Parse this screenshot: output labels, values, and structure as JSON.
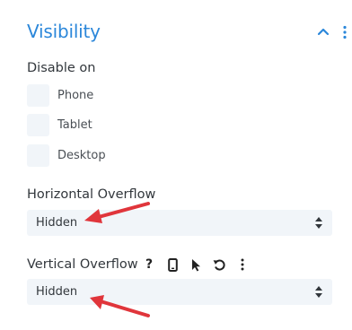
{
  "section": {
    "title": "Visibility",
    "collapse_icon": "chevron-up-icon",
    "more_icon": "vertical-dots-icon"
  },
  "disable_on": {
    "label": "Disable on",
    "options": [
      {
        "label": "Phone",
        "checked": false
      },
      {
        "label": "Tablet",
        "checked": false
      },
      {
        "label": "Desktop",
        "checked": false
      }
    ]
  },
  "horizontal_overflow": {
    "label": "Horizontal Overflow",
    "value": "Hidden"
  },
  "vertical_overflow": {
    "label": "Vertical Overflow",
    "value": "Hidden",
    "help_glyph": "?",
    "tools": [
      "help-icon",
      "phone-icon",
      "cursor-icon",
      "undo-icon",
      "vertical-dots-icon"
    ]
  },
  "colors": {
    "accent": "#2b87da",
    "field_bg": "#f1f5f9",
    "annotation_arrow": "#e0353b"
  }
}
